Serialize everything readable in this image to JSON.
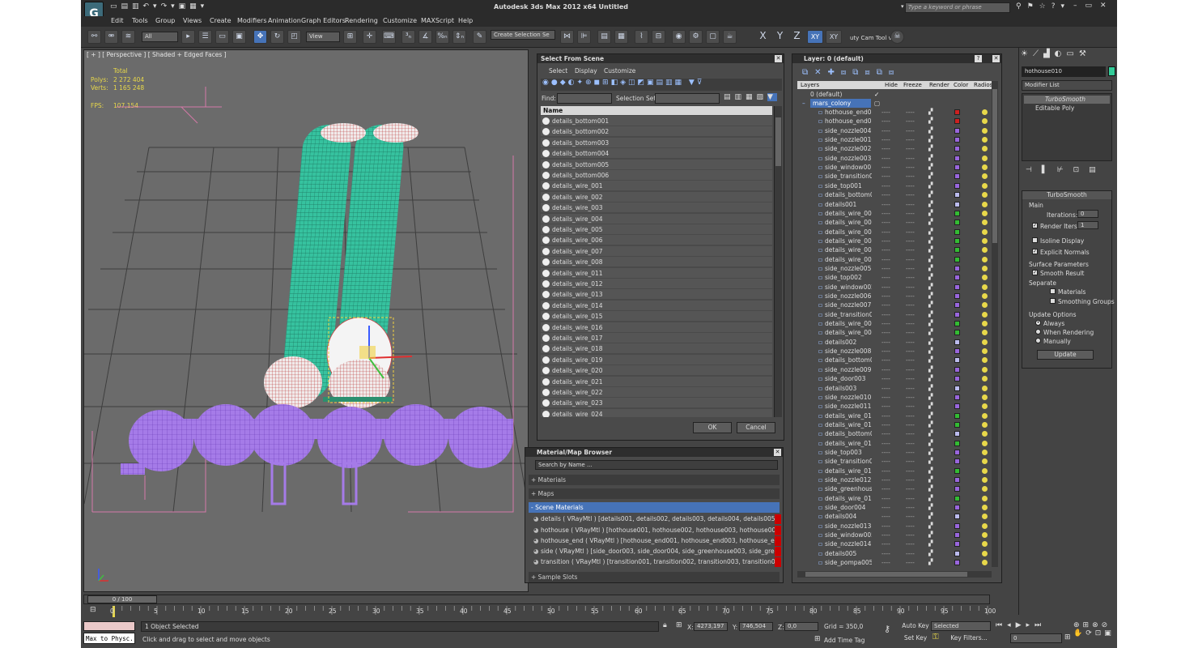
{
  "window": {
    "title": "Autodesk 3ds Max  2012 x64      Untitled",
    "search_placeholder": "Type a keyword or phrase"
  },
  "menu": [
    "Edit",
    "Tools",
    "Group",
    "Views",
    "Create",
    "Modifiers",
    "Animation",
    "Graph Editors",
    "Rendering",
    "Customize",
    "MAXScript",
    "Help"
  ],
  "toolbar": {
    "filter": "All",
    "ref_coord": "View",
    "named_sel": "Create Selection Se",
    "axis_x": "X",
    "axis_y": "Y",
    "axis_z": "Z",
    "axis_xy": "XY",
    "axis_xy2": "XY",
    "cam_tool": "uty Cam Tool v"
  },
  "viewport": {
    "label": "[ + ] [ Perspective ] [ Shaded + Edged Faces ]",
    "total": "Total",
    "polys_label": "Polys:",
    "polys": "2 272 404",
    "verts_label": "Verts:",
    "verts": "1 165 248",
    "fps_label": "FPS:",
    "fps": "107,154"
  },
  "select_scene": {
    "title": "Select From Scene",
    "menu": [
      "Select",
      "Display",
      "Customize"
    ],
    "find_label": "Find:",
    "selset_label": "Selection Set:",
    "col_name": "Name",
    "items": [
      "details_bottom001",
      "details_bottom002",
      "details_bottom003",
      "details_bottom004",
      "details_bottom005",
      "details_bottom006",
      "details_wire_001",
      "details_wire_002",
      "details_wire_003",
      "details_wire_004",
      "details_wire_005",
      "details_wire_006",
      "details_wire_007",
      "details_wire_008",
      "details_wire_011",
      "details_wire_012",
      "details_wire_013",
      "details_wire_014",
      "details_wire_015",
      "details_wire_016",
      "details_wire_017",
      "details_wire_018",
      "details_wire_019",
      "details_wire_020",
      "details_wire_021",
      "details_wire_022",
      "details_wire_023",
      "details_wire_024"
    ],
    "ok": "OK",
    "cancel": "Cancel"
  },
  "material_browser": {
    "title": "Material/Map Browser",
    "search_placeholder": "Search by Name ...",
    "materials": "+ Materials",
    "maps": "+ Maps",
    "scene_materials": "- Scene Materials",
    "rows": [
      "details  ( VRayMtl ) [details001, details002, details003, details004, details005, de...",
      "hothouse  ( VRayMtl ) [hothouse001, hothouse002, hothouse003, hothouse004,...",
      "hothouse_end  ( VRayMtl ) [hothouse_end001, hothouse_end003, hothouse_en...",
      "side  ( VRayMtl ) [side_door003, side_door004, side_greenhouse003, side_green...",
      "transition  ( VRayMtl ) [transition001, transition002, transition003, transition004,..."
    ],
    "sample_slots": "+ Sample Slots"
  },
  "layers": {
    "title": "Layer: 0 (default)",
    "cols": [
      "Layers",
      "Hide",
      "Freeze",
      "Render",
      "Color",
      "Radios"
    ],
    "default_layer": "0 (default)",
    "mars_layer": "mars_colony",
    "items": [
      {
        "n": "hothouse_end00",
        "c": "#cc2020"
      },
      {
        "n": "hothouse_end00",
        "c": "#cc2020"
      },
      {
        "n": "side_nozzle004",
        "c": "#9966dd"
      },
      {
        "n": "side_nozzle001",
        "c": "#9966dd"
      },
      {
        "n": "side_nozzle002",
        "c": "#9966dd"
      },
      {
        "n": "side_nozzle003",
        "c": "#9966dd"
      },
      {
        "n": "side_window001",
        "c": "#9966dd"
      },
      {
        "n": "side_transition0",
        "c": "#9966dd"
      },
      {
        "n": "side_top001",
        "c": "#9966dd"
      },
      {
        "n": "details_bottom0",
        "c": "#bbbbee"
      },
      {
        "n": "details001",
        "c": "#bbbbee"
      },
      {
        "n": "details_wire_001",
        "c": "#33bb33"
      },
      {
        "n": "details_wire_004",
        "c": "#33bb33"
      },
      {
        "n": "details_wire_005",
        "c": "#33bb33"
      },
      {
        "n": "details_wire_002",
        "c": "#33bb33"
      },
      {
        "n": "details_wire_003",
        "c": "#33bb33"
      },
      {
        "n": "details_wire_006",
        "c": "#33bb33"
      },
      {
        "n": "side_nozzle005",
        "c": "#9966dd"
      },
      {
        "n": "side_top002",
        "c": "#9966dd"
      },
      {
        "n": "side_window002",
        "c": "#9966dd"
      },
      {
        "n": "side_nozzle006",
        "c": "#9966dd"
      },
      {
        "n": "side_nozzle007",
        "c": "#9966dd"
      },
      {
        "n": "side_transition0",
        "c": "#9966dd"
      },
      {
        "n": "details_wire_007",
        "c": "#33bb33"
      },
      {
        "n": "details_wire_008",
        "c": "#33bb33"
      },
      {
        "n": "details002",
        "c": "#bbbbee"
      },
      {
        "n": "side_nozzle008",
        "c": "#9966dd"
      },
      {
        "n": "details_bottom0",
        "c": "#bbbbee"
      },
      {
        "n": "side_nozzle009",
        "c": "#9966dd"
      },
      {
        "n": "side_door003",
        "c": "#9966dd"
      },
      {
        "n": "details003",
        "c": "#bbbbee"
      },
      {
        "n": "side_nozzle010",
        "c": "#9966dd"
      },
      {
        "n": "side_nozzle011",
        "c": "#9966dd"
      },
      {
        "n": "details_wire_011",
        "c": "#33bb33"
      },
      {
        "n": "details_wire_012",
        "c": "#33bb33"
      },
      {
        "n": "details_bottom0",
        "c": "#bbbbee"
      },
      {
        "n": "details_wire_013",
        "c": "#33bb33"
      },
      {
        "n": "side_top003",
        "c": "#9966dd"
      },
      {
        "n": "side_transition0",
        "c": "#9966dd"
      },
      {
        "n": "details_wire_014",
        "c": "#33bb33"
      },
      {
        "n": "side_nozzle012",
        "c": "#9966dd"
      },
      {
        "n": "side_greenhouse",
        "c": "#9966dd"
      },
      {
        "n": "details_wire_015",
        "c": "#33bb33"
      },
      {
        "n": "side_door004",
        "c": "#9966dd"
      },
      {
        "n": "details004",
        "c": "#bbbbee"
      },
      {
        "n": "side_nozzle013",
        "c": "#9966dd"
      },
      {
        "n": "side_window005",
        "c": "#9966dd"
      },
      {
        "n": "side_nozzle014",
        "c": "#9966dd"
      },
      {
        "n": "details005",
        "c": "#bbbbee"
      },
      {
        "n": "side_pompa005",
        "c": "#9966dd"
      }
    ],
    "dash": "----",
    "teapot": "▞"
  },
  "command_panel": {
    "object_name": "hothouse010",
    "modifier_list": "Modifier List",
    "stack": [
      "TurboSmooth",
      "Editable Poly"
    ],
    "rollout": "TurboSmooth",
    "main": "Main",
    "iterations_label": "Iterations:",
    "iterations": "0",
    "render_iters_label": "Render Iters:",
    "render_iters": "1",
    "isoline": "Isoline Display",
    "explicit": "Explicit Normals",
    "surface_params": "Surface Parameters",
    "smooth_result": "Smooth Result",
    "separate": "Separate",
    "materials": "Materials",
    "smoothing_groups": "Smoothing Groups",
    "update_options": "Update Options",
    "always": "Always",
    "when_rendering": "When Rendering",
    "manually": "Manually",
    "update": "Update"
  },
  "timeline": {
    "frame": "0 / 100",
    "ticks": [
      "0",
      "5",
      "10",
      "15",
      "20",
      "25",
      "30",
      "35",
      "40",
      "45",
      "50",
      "55",
      "60",
      "65",
      "70",
      "75",
      "80",
      "85",
      "90",
      "95",
      "100"
    ]
  },
  "status": {
    "script": "Max to Physc.",
    "selected": "1 Object Selected",
    "prompt": "Click and drag to select and move objects",
    "x_label": "X:",
    "x": "4273,197",
    "y_label": "Y:",
    "y": "746,504",
    "z_label": "Z:",
    "z": "0,0",
    "grid": "Grid = 350,0",
    "add_time_tag": "Add Time Tag",
    "auto_key": "Auto Key",
    "set_key": "Set Key",
    "sel_mode": "Selected",
    "key_filters": "Key Filters...",
    "frame_field": "0"
  }
}
